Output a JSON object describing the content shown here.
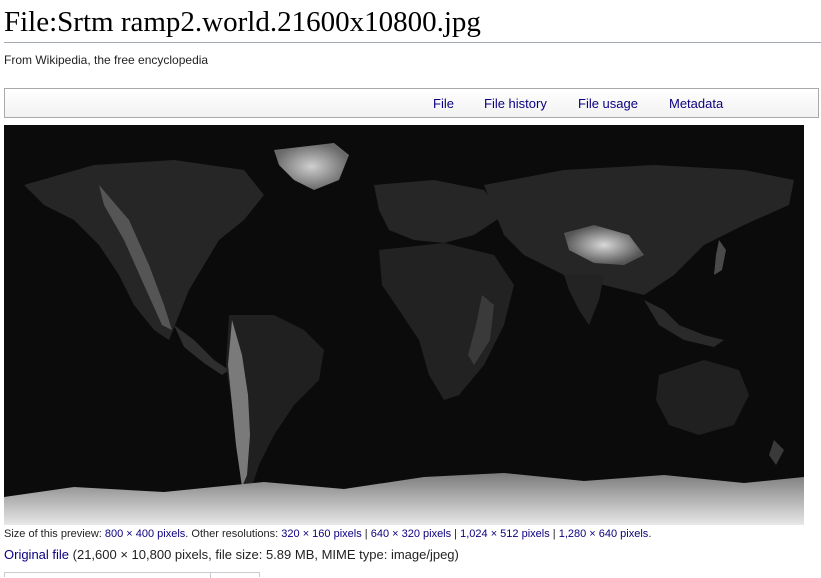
{
  "page": {
    "title": "File:Srtm ramp2.world.21600x10800.jpg",
    "tagline": "From Wikipedia, the free encyclopedia"
  },
  "file_toc": {
    "items": [
      {
        "label": "File"
      },
      {
        "label": "File history"
      },
      {
        "label": "File usage"
      },
      {
        "label": "Metadata"
      }
    ]
  },
  "preview": {
    "size_prefix": "Size of this preview: ",
    "size_link": "800 × 400 pixels",
    "other_prefix": ". Other resolutions: ",
    "resolutions": [
      "320 × 160 pixels",
      "640 × 320 pixels",
      "1,024 × 512 pixels",
      "1,280 × 640 pixels"
    ],
    "separator": " | ",
    "suffix": "."
  },
  "original": {
    "link": "Original file",
    "details": " (21,600 × 10,800 pixels, file size: 5.89 MB, MIME type: image/jpeg)"
  },
  "colors": {
    "link": "#0b0080",
    "map_background": "#0b0b0b"
  }
}
